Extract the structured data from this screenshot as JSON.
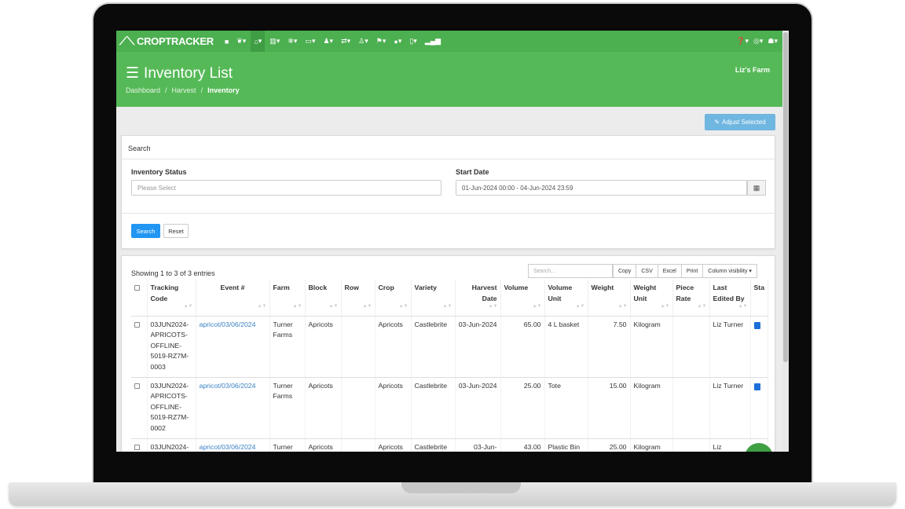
{
  "nav": {
    "logo": "CROPTRACKER",
    "logo_icon": "leaf-sprout-icon",
    "items": [
      "▾",
      "▾",
      "▾",
      "▾",
      "▾",
      "▾",
      "▾",
      "▾",
      "▾",
      "▾",
      "▾",
      "▾",
      "▾"
    ],
    "right": [
      "▾",
      "▾",
      "▾"
    ]
  },
  "header": {
    "title": "Inventory List",
    "farm": "Liz's Farm",
    "breadcrumb": [
      "Dashboard",
      "Harvest",
      "Inventory"
    ],
    "separator": "/"
  },
  "actions": {
    "adjust_selected": "Adjust Selected"
  },
  "search_panel": {
    "heading": "Search",
    "inventory_status_label": "Inventory Status",
    "inventory_status_placeholder": "Please Select",
    "start_date_label": "Start Date",
    "start_date_value": "01-Jun-2024 00:00 - 04-Jun-2024 23:59",
    "search_button": "Search",
    "reset_button": "Reset"
  },
  "table_panel": {
    "showing": "Showing 1 to 3 of 3 entries",
    "search_placeholder": "Search...",
    "buttons": [
      "Copy",
      "CSV",
      "Excel",
      "Print",
      "Column visibility ▾"
    ],
    "columns": [
      "Tracking Code",
      "Event #",
      "Farm",
      "Block",
      "Row",
      "Crop",
      "Variety",
      "Harvest Date",
      "Volume",
      "Volume Unit",
      "Weight",
      "Weight Unit",
      "Piece Rate",
      "Last Edited By",
      "Sta"
    ],
    "rows": [
      {
        "tracking_code": "03JUN2024-APRICOTS-OFFLINE-5019-RZ7M-0003",
        "event": "apricot/03/06/2024",
        "farm": "Turner Farms",
        "block": "Apricots",
        "row": "",
        "crop": "Apricots",
        "variety": "Castlebrite",
        "harvest_date": "03-Jun-2024",
        "volume": "65.00",
        "volume_unit": "4 L basket",
        "weight": "7.50",
        "weight_unit": "Kilogram",
        "piece_rate": "",
        "last_edited_by": "Liz Turner"
      },
      {
        "tracking_code": "03JUN2024-APRICOTS-OFFLINE-5019-RZ7M-0002",
        "event": "apricot/03/06/2024",
        "farm": "Turner Farms",
        "block": "Apricots",
        "row": "",
        "crop": "Apricots",
        "variety": "Castlebrite",
        "harvest_date": "03-Jun-2024",
        "volume": "25.00",
        "volume_unit": "Tote",
        "weight": "15.00",
        "weight_unit": "Kilogram",
        "piece_rate": "",
        "last_edited_by": "Liz Turner"
      },
      {
        "tracking_code": "03JUN2024-",
        "event": "apricot/03/06/2024",
        "farm": "Turner",
        "block": "Apricots",
        "row": "",
        "crop": "Apricots",
        "variety": "Castlebrite",
        "harvest_date": "03-Jun-",
        "volume": "43.00",
        "volume_unit": "Plastic Bin",
        "weight": "25.00",
        "weight_unit": "Kilogram",
        "piece_rate": "",
        "last_edited_by": "Liz"
      }
    ]
  },
  "colors": {
    "nav": "#4caf50",
    "header": "#55b957",
    "primary": "#2196f3",
    "link": "#3b82c4"
  }
}
